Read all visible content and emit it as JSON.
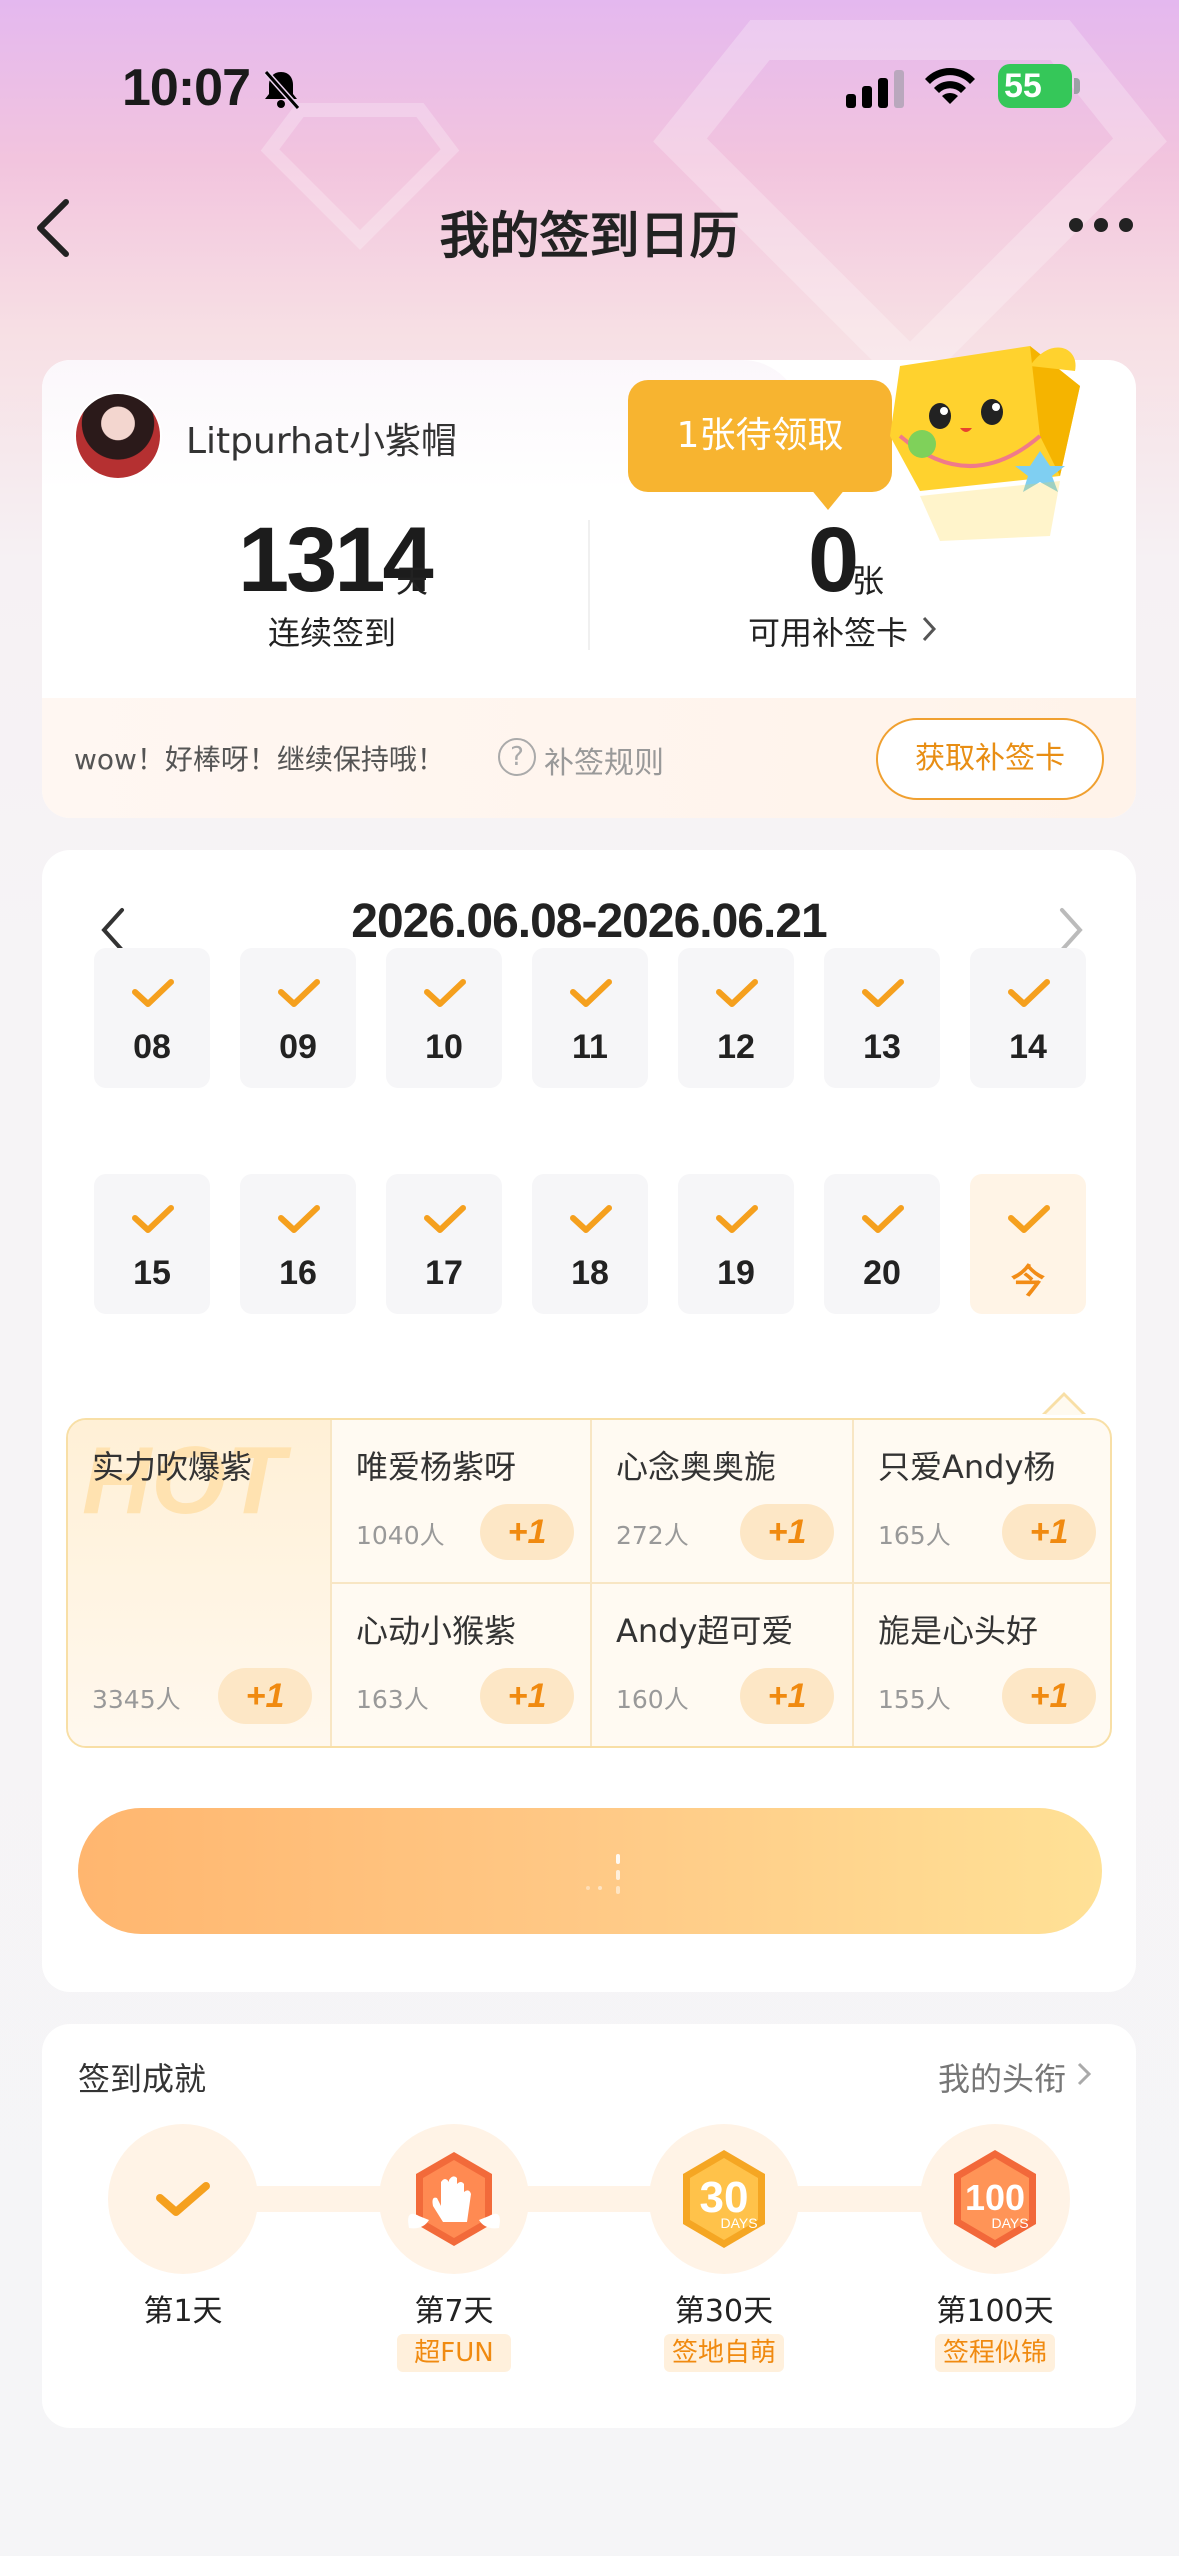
{
  "status_bar": {
    "time": "10:07",
    "battery": "55"
  },
  "header": {
    "title": "我的签到日历"
  },
  "profile": {
    "username": "Litpurhat小紫帽"
  },
  "stats": {
    "streak_value": "1314",
    "streak_unit": "天",
    "streak_label": "连续签到",
    "cards_value": "0",
    "cards_unit": "张",
    "cards_label": "可用补签卡"
  },
  "tooltip": {
    "text": "1张待领取"
  },
  "encourage": {
    "text": "wow！好棒呀！继续保持哦！",
    "rules_icon": "?",
    "rules_label": "补签规则",
    "button": "获取补签卡"
  },
  "calendar": {
    "range": "2026.06.08-2026.06.21",
    "week1": [
      "08",
      "09",
      "10",
      "11",
      "12",
      "13",
      "14"
    ],
    "week2": [
      "15",
      "16",
      "17",
      "18",
      "19",
      "20",
      "今"
    ]
  },
  "ranking": {
    "first": {
      "name": "实力吹爆紫",
      "count": "3345人",
      "plus": "+1",
      "watermark": "HOT"
    },
    "others": [
      {
        "name": "唯爱杨紫呀",
        "count": "1040人",
        "plus": "+1"
      },
      {
        "name": "心念奥奥旎",
        "count": "272人",
        "plus": "+1"
      },
      {
        "name": "只爱Andy杨",
        "count": "165人",
        "plus": "+1"
      },
      {
        "name": "心动小猴紫",
        "count": "163人",
        "plus": "+1"
      },
      {
        "name": "Andy超可爱",
        "count": "160人",
        "plus": "+1"
      },
      {
        "name": "旎是心头好",
        "count": "155人",
        "plus": "+1"
      }
    ]
  },
  "achievements": {
    "title": "签到成就",
    "link": "我的头衔",
    "items": [
      {
        "label": "第1天",
        "tag": ""
      },
      {
        "label": "第7天",
        "tag": "超FUN"
      },
      {
        "label": "第30天",
        "tag": "签地自萌",
        "badge_text": "30",
        "badge_sub": "DAYS"
      },
      {
        "label": "第100天",
        "tag": "签程似锦",
        "badge_text": "100",
        "badge_sub": "DAYS"
      }
    ]
  },
  "colors": {
    "accent": "#f08a10",
    "tooltip": "#f7b430",
    "check": "#f5a01e"
  }
}
